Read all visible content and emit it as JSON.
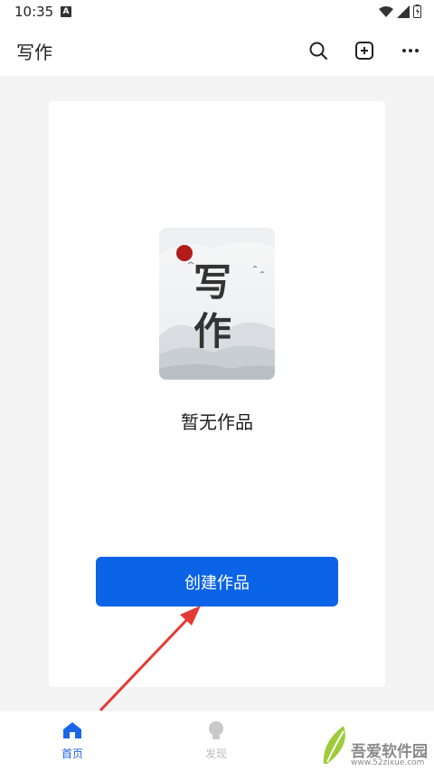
{
  "status_bar": {
    "time": "10:35",
    "notification_badge": "A"
  },
  "app_bar": {
    "title": "写作",
    "icons": [
      "search-icon",
      "add-box-icon",
      "more-icon"
    ]
  },
  "card": {
    "illustration_title": "写作",
    "empty_text": "暂无作品",
    "create_button_label": "创建作品"
  },
  "bottom_nav": {
    "items": [
      {
        "label": "首页",
        "icon": "home-icon",
        "active": true
      },
      {
        "label": "发现",
        "icon": "bulb-icon",
        "active": false
      }
    ]
  },
  "watermark": {
    "text": "吾爱软件园",
    "url": "www.52zixue.com"
  },
  "colors": {
    "accent": "#0b63e6",
    "nav_active": "#1a66e6",
    "arrow": "#e53935",
    "background": "#f4f4f4"
  }
}
